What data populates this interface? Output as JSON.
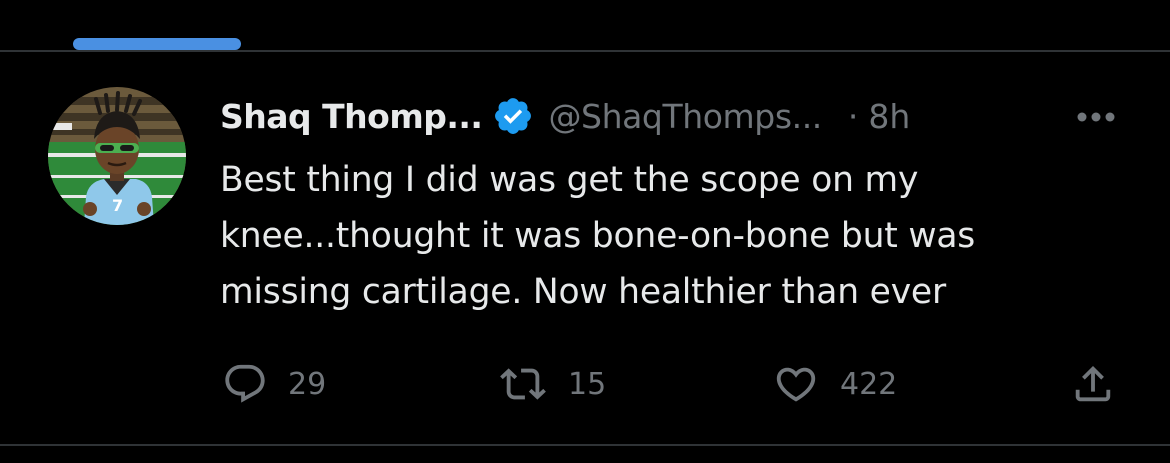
{
  "tweet": {
    "display_name": "Shaq Thomp...",
    "handle": "@ShaqThomps...",
    "separator": "·",
    "timestamp": "8h",
    "text": "Best thing I did was get the scope on my\nknee...thought it was bone-on-bone but was\nmissing cartilage. Now healthier than ever",
    "avatar_jersey_number": "7"
  },
  "actions": {
    "reply_count": "29",
    "retweet_count": "15",
    "like_count": "422"
  },
  "colors": {
    "background": "#000000",
    "text_primary": "#e7e9ea",
    "text_secondary": "#71767b",
    "accent_blue": "#1d9bf0",
    "tab_indicator": "#4a90e2",
    "divider": "#2f3336"
  },
  "icons": {
    "verified": "verified-badge-icon",
    "more": "more-horizontal-icon",
    "reply": "reply-icon",
    "retweet": "retweet-icon",
    "like": "heart-icon",
    "share": "share-icon"
  }
}
